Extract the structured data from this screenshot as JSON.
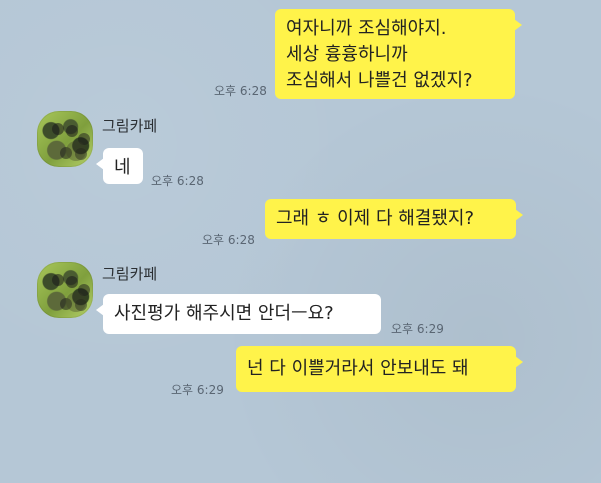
{
  "messages": [
    {
      "direction": "out",
      "text": "여자니까 조심해야지.\n세상 흉흉하니까\n조심해서 나쁠건 없겠지?",
      "time": "오후 6:28"
    },
    {
      "direction": "in",
      "sender": "그림카페",
      "text": "네",
      "time": "오후 6:28"
    },
    {
      "direction": "out",
      "text": "그래 ㅎ 이제 다 해결됐지?",
      "time": "오후 6:28"
    },
    {
      "direction": "in",
      "sender": "그림카페",
      "text": "사진평가 해주시면 안더ㅡ요?",
      "time": "오후 6:29"
    },
    {
      "direction": "out",
      "text": "넌 다 이쁠거라서 안보내도 돼",
      "time": "오후 6:29"
    }
  ]
}
